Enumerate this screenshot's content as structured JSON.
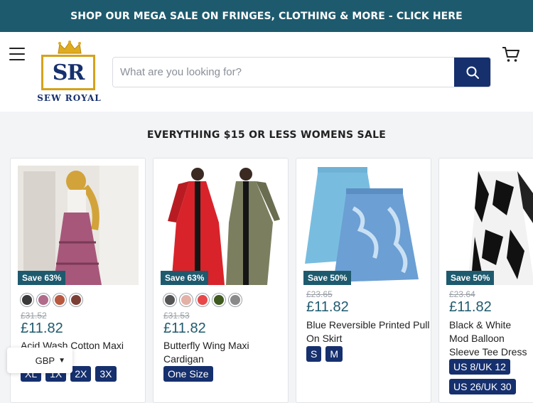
{
  "announcement": "SHOP OUR MEGA SALE ON FRINGES, CLOTHING & MORE - CLICK HERE",
  "logo": {
    "initials": "SR",
    "name": "SEW ROYAL"
  },
  "search": {
    "placeholder": "What are you looking for?"
  },
  "section_title": "EVERYTHING $15 OR LESS WOMENS SALE",
  "products": [
    {
      "badge": "Save 63%",
      "was": "£31.52",
      "price": "£11.82",
      "name": "Acid Wash Cotton Maxi",
      "swatches": [
        "#3a3a3a",
        "#b06a8a",
        "#b8583f",
        "#7b3f36"
      ],
      "sizes": [
        "XL",
        "1X",
        "2X",
        "3X"
      ]
    },
    {
      "badge": "Save 63%",
      "was": "£31.53",
      "price": "£11.82",
      "name": "Butterfly Wing Maxi Cardigan",
      "swatches": [
        "#555555",
        "#e3b1a6",
        "#e8474a",
        "#3f5a1e",
        "#8a8a8a"
      ],
      "sizes": [
        "One Size"
      ]
    },
    {
      "badge": "Save 50%",
      "was": "£23.65",
      "price": "£11.82",
      "name": "Blue Reversible Printed Pull On Skirt",
      "swatches": [],
      "sizes": [
        "S",
        "M"
      ]
    },
    {
      "badge": "Save 50%",
      "was": "£23.64",
      "price": "£11.82",
      "name": "Black & White Mod Balloon Sleeve Tee Dress",
      "swatches": [],
      "sizes": [
        "US 8/UK 12",
        "US 26/UK 30"
      ]
    }
  ],
  "currency": "GBP"
}
